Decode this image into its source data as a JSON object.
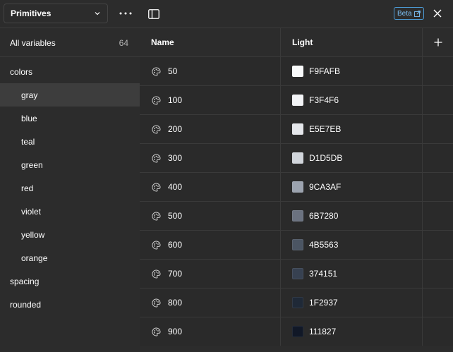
{
  "sidebar": {
    "collection": "Primitives",
    "all_variables": {
      "label": "All variables",
      "count": "64"
    },
    "groups": [
      {
        "label": "colors",
        "sub": false,
        "selected": false
      },
      {
        "label": "gray",
        "sub": true,
        "selected": true
      },
      {
        "label": "blue",
        "sub": true,
        "selected": false
      },
      {
        "label": "teal",
        "sub": true,
        "selected": false
      },
      {
        "label": "green",
        "sub": true,
        "selected": false
      },
      {
        "label": "red",
        "sub": true,
        "selected": false
      },
      {
        "label": "violet",
        "sub": true,
        "selected": false
      },
      {
        "label": "yellow",
        "sub": true,
        "selected": false
      },
      {
        "label": "orange",
        "sub": true,
        "selected": false
      },
      {
        "label": "spacing",
        "sub": false,
        "selected": false
      },
      {
        "label": "rounded",
        "sub": false,
        "selected": false
      }
    ]
  },
  "topbar": {
    "beta_label": "Beta"
  },
  "table": {
    "headers": {
      "name": "Name",
      "mode": "Light"
    },
    "rows": [
      {
        "name": "50",
        "hex": "F9FAFB",
        "color": "#F9FAFB"
      },
      {
        "name": "100",
        "hex": "F3F4F6",
        "color": "#F3F4F6"
      },
      {
        "name": "200",
        "hex": "E5E7EB",
        "color": "#E5E7EB"
      },
      {
        "name": "300",
        "hex": "D1D5DB",
        "color": "#D1D5DB"
      },
      {
        "name": "400",
        "hex": "9CA3AF",
        "color": "#9CA3AF"
      },
      {
        "name": "500",
        "hex": "6B7280",
        "color": "#6B7280"
      },
      {
        "name": "600",
        "hex": "4B5563",
        "color": "#4B5563"
      },
      {
        "name": "700",
        "hex": "374151",
        "color": "#374151"
      },
      {
        "name": "800",
        "hex": "1F2937",
        "color": "#1F2937"
      },
      {
        "name": "900",
        "hex": "111827",
        "color": "#111827"
      }
    ]
  },
  "icons": {
    "collection_chevron": "chevron-down-icon",
    "more": "more-horizontal-icon",
    "sidebar_toggle": "sidebar-toggle-icon",
    "external_link": "external-link-icon",
    "close": "close-icon",
    "add_mode": "plus-icon",
    "variable": "color-variable-icon"
  }
}
